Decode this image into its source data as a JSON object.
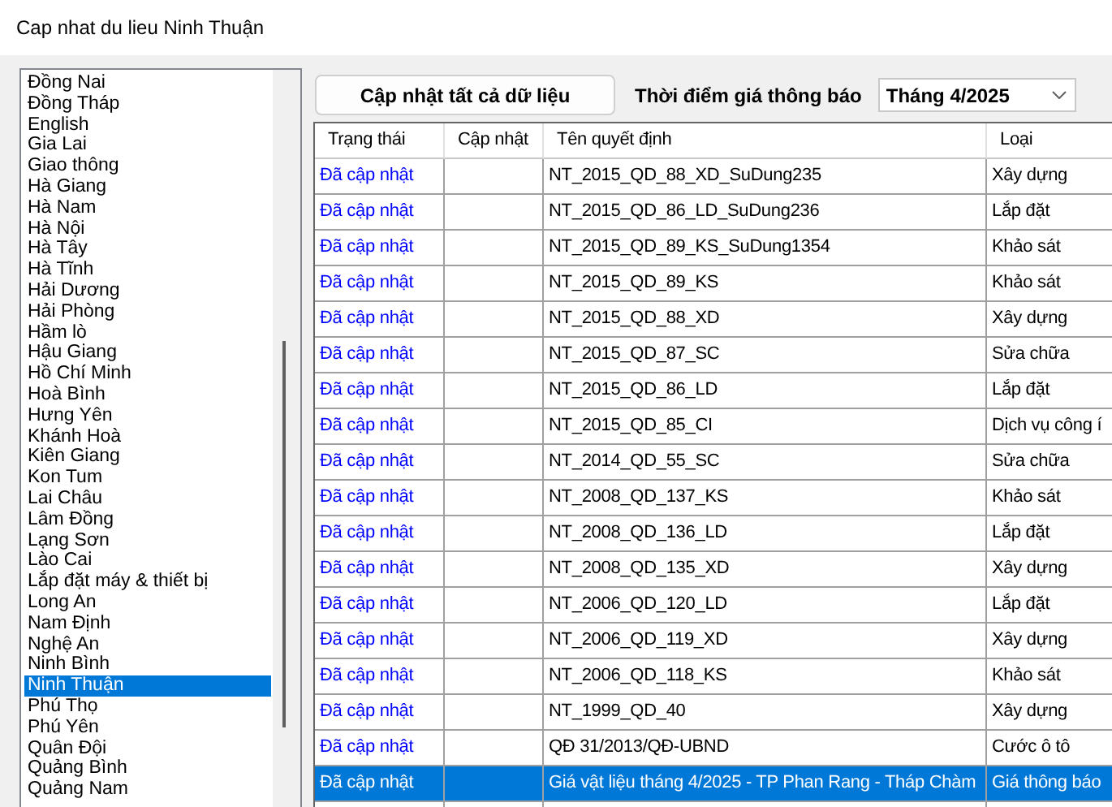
{
  "window": {
    "title": "Cap nhat du lieu Ninh Thuận"
  },
  "sidebar": {
    "items": [
      {
        "label": "Đồng Nai",
        "selected": false
      },
      {
        "label": "Đồng Tháp",
        "selected": false
      },
      {
        "label": "English",
        "selected": false
      },
      {
        "label": "Gia Lai",
        "selected": false
      },
      {
        "label": "Giao thông",
        "selected": false
      },
      {
        "label": "Hà Giang",
        "selected": false
      },
      {
        "label": "Hà Nam",
        "selected": false
      },
      {
        "label": "Hà Nội",
        "selected": false
      },
      {
        "label": "Hà Tây",
        "selected": false
      },
      {
        "label": "Hà Tĩnh",
        "selected": false
      },
      {
        "label": "Hải Dương",
        "selected": false
      },
      {
        "label": "Hải Phòng",
        "selected": false
      },
      {
        "label": "Hầm lò",
        "selected": false
      },
      {
        "label": "Hậu Giang",
        "selected": false
      },
      {
        "label": "Hồ Chí Minh",
        "selected": false
      },
      {
        "label": "Hoà Bình",
        "selected": false
      },
      {
        "label": "Hưng Yên",
        "selected": false
      },
      {
        "label": "Khánh Hoà",
        "selected": false
      },
      {
        "label": "Kiên Giang",
        "selected": false
      },
      {
        "label": "Kon Tum",
        "selected": false
      },
      {
        "label": "Lai Châu",
        "selected": false
      },
      {
        "label": "Lâm Đồng",
        "selected": false
      },
      {
        "label": "Lạng Sơn",
        "selected": false
      },
      {
        "label": "Lào Cai",
        "selected": false
      },
      {
        "label": "Lắp đặt máy & thiết bị",
        "selected": false
      },
      {
        "label": "Long An",
        "selected": false
      },
      {
        "label": "Nam Định",
        "selected": false
      },
      {
        "label": "Nghệ An",
        "selected": false
      },
      {
        "label": "Ninh Bình",
        "selected": false
      },
      {
        "label": "Ninh Thuận",
        "selected": true
      },
      {
        "label": "Phú Thọ",
        "selected": false
      },
      {
        "label": "Phú Yên",
        "selected": false
      },
      {
        "label": "Quân Đội",
        "selected": false
      },
      {
        "label": "Quảng Bình",
        "selected": false
      },
      {
        "label": "Quảng Nam",
        "selected": false
      }
    ]
  },
  "toolbar": {
    "update_all_button": "Cập nhật tất cả dữ liệu",
    "period_label": "Thời điểm giá thông báo",
    "period_select": {
      "value": "Tháng 4/2025"
    }
  },
  "table": {
    "columns": [
      "Trạng thái",
      "Cập nhật",
      "Tên quyết định",
      "Loại"
    ],
    "rows": [
      {
        "status": "Đã cập nhật",
        "name": "NT_2015_QD_88_XD_SuDung235",
        "type": "Xây dựng",
        "selected": false
      },
      {
        "status": "Đã cập nhật",
        "name": "NT_2015_QD_86_LD_SuDung236",
        "type": "Lắp đặt",
        "selected": false
      },
      {
        "status": "Đã cập nhật",
        "name": "NT_2015_QD_89_KS_SuDung1354",
        "type": "Khảo sát",
        "selected": false
      },
      {
        "status": "Đã cập nhật",
        "name": "NT_2015_QD_89_KS",
        "type": "Khảo sát",
        "selected": false
      },
      {
        "status": "Đã cập nhật",
        "name": "NT_2015_QD_88_XD",
        "type": "Xây dựng",
        "selected": false
      },
      {
        "status": "Đã cập nhật",
        "name": "NT_2015_QD_87_SC",
        "type": "Sửa chữa",
        "selected": false
      },
      {
        "status": "Đã cập nhật",
        "name": "NT_2015_QD_86_LD",
        "type": "Lắp đặt",
        "selected": false
      },
      {
        "status": "Đã cập nhật",
        "name": "NT_2015_QD_85_CI",
        "type": "Dịch vụ công í",
        "selected": false
      },
      {
        "status": "Đã cập nhật",
        "name": "NT_2014_QD_55_SC",
        "type": "Sửa chữa",
        "selected": false
      },
      {
        "status": "Đã cập nhật",
        "name": "NT_2008_QD_137_KS",
        "type": "Khảo sát",
        "selected": false
      },
      {
        "status": "Đã cập nhật",
        "name": "NT_2008_QD_136_LD",
        "type": "Lắp đặt",
        "selected": false
      },
      {
        "status": "Đã cập nhật",
        "name": "NT_2008_QD_135_XD",
        "type": "Xây dựng",
        "selected": false
      },
      {
        "status": "Đã cập nhật",
        "name": "NT_2006_QD_120_LD",
        "type": "Lắp đặt",
        "selected": false
      },
      {
        "status": "Đã cập nhật",
        "name": "NT_2006_QD_119_XD",
        "type": "Xây dựng",
        "selected": false
      },
      {
        "status": "Đã cập nhật",
        "name": "NT_2006_QD_118_KS",
        "type": "Khảo sát",
        "selected": false
      },
      {
        "status": "Đã cập nhật",
        "name": "NT_1999_QD_40",
        "type": "Xây dựng",
        "selected": false
      },
      {
        "status": "Đã cập nhật",
        "name": "QĐ 31/2013/QĐ-UBND",
        "type": "Cước ô tô",
        "selected": false
      },
      {
        "status": "Đã cập nhật",
        "name": "Giá vật liệu tháng 4/2025 - TP Phan Rang - Tháp Chàm",
        "type": "Giá thông báo",
        "selected": true
      }
    ]
  }
}
